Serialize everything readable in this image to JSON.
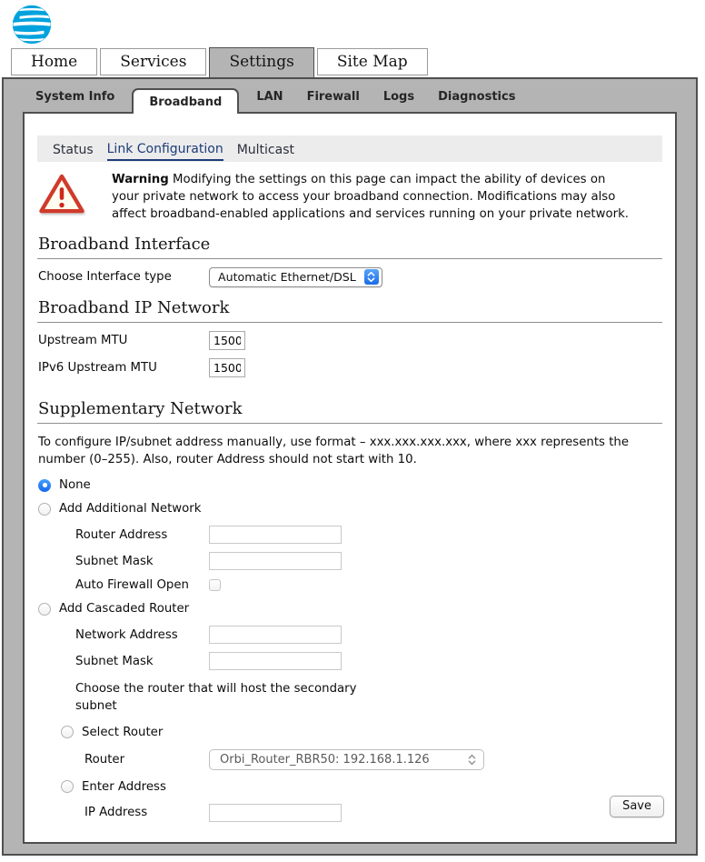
{
  "logo": {
    "name": "att-globe"
  },
  "colors": {
    "att_blue": "#00a2dd",
    "frame_gray": "#b4b4b4",
    "nav_active_blue": "#1d3c78",
    "accent_blue": "#1e7bf4",
    "warning_red": "#d03a2b"
  },
  "main_tabs": [
    "Home",
    "Services",
    "Settings",
    "Site Map"
  ],
  "sub_tabs": [
    "System Info",
    "Broadband",
    "LAN",
    "Firewall",
    "Logs",
    "Diagnostics"
  ],
  "section_tabs": [
    "Status",
    "Link Configuration",
    "Multicast"
  ],
  "warning": {
    "title": "Warning",
    "body": "Modifying the settings on this page can impact the ability of devices on your private network to access your broadband connection. Modifications may also affect broadband-enabled applications and services running on your private network."
  },
  "broadband_interface": {
    "heading": "Broadband Interface",
    "interface_label": "Choose Interface type",
    "interface_value": "Automatic Ethernet/DSL"
  },
  "broadband_ip": {
    "heading": "Broadband IP Network",
    "upstream_mtu_label": "Upstream MTU",
    "upstream_mtu_value": "1500",
    "ipv6_mtu_label": "IPv6 Upstream MTU",
    "ipv6_mtu_value": "1500"
  },
  "supplementary": {
    "heading": "Supplementary Network",
    "description": "To configure IP/subnet address manually, use format – xxx.xxx.xxx.xxx, where xxx represents the number (0–255). Also, router Address should not start with 10.",
    "none_label": "None",
    "add_network_label": "Add Additional Network",
    "router_address_label": "Router Address",
    "subnet_mask_label": "Subnet Mask",
    "auto_firewall_label": "Auto Firewall Open",
    "add_cascaded_label": "Add Cascaded Router",
    "network_address_label": "Network Address",
    "cascaded_subnet_mask_label": "Subnet Mask",
    "host_router_note": "Choose the router that will host the secondary subnet",
    "select_router_label": "Select Router",
    "router_label": "Router",
    "router_value": "Orbi_Router_RBR50: 192.168.1.126",
    "enter_address_label": "Enter Address",
    "ip_address_label": "IP Address"
  },
  "save_label": "Save"
}
